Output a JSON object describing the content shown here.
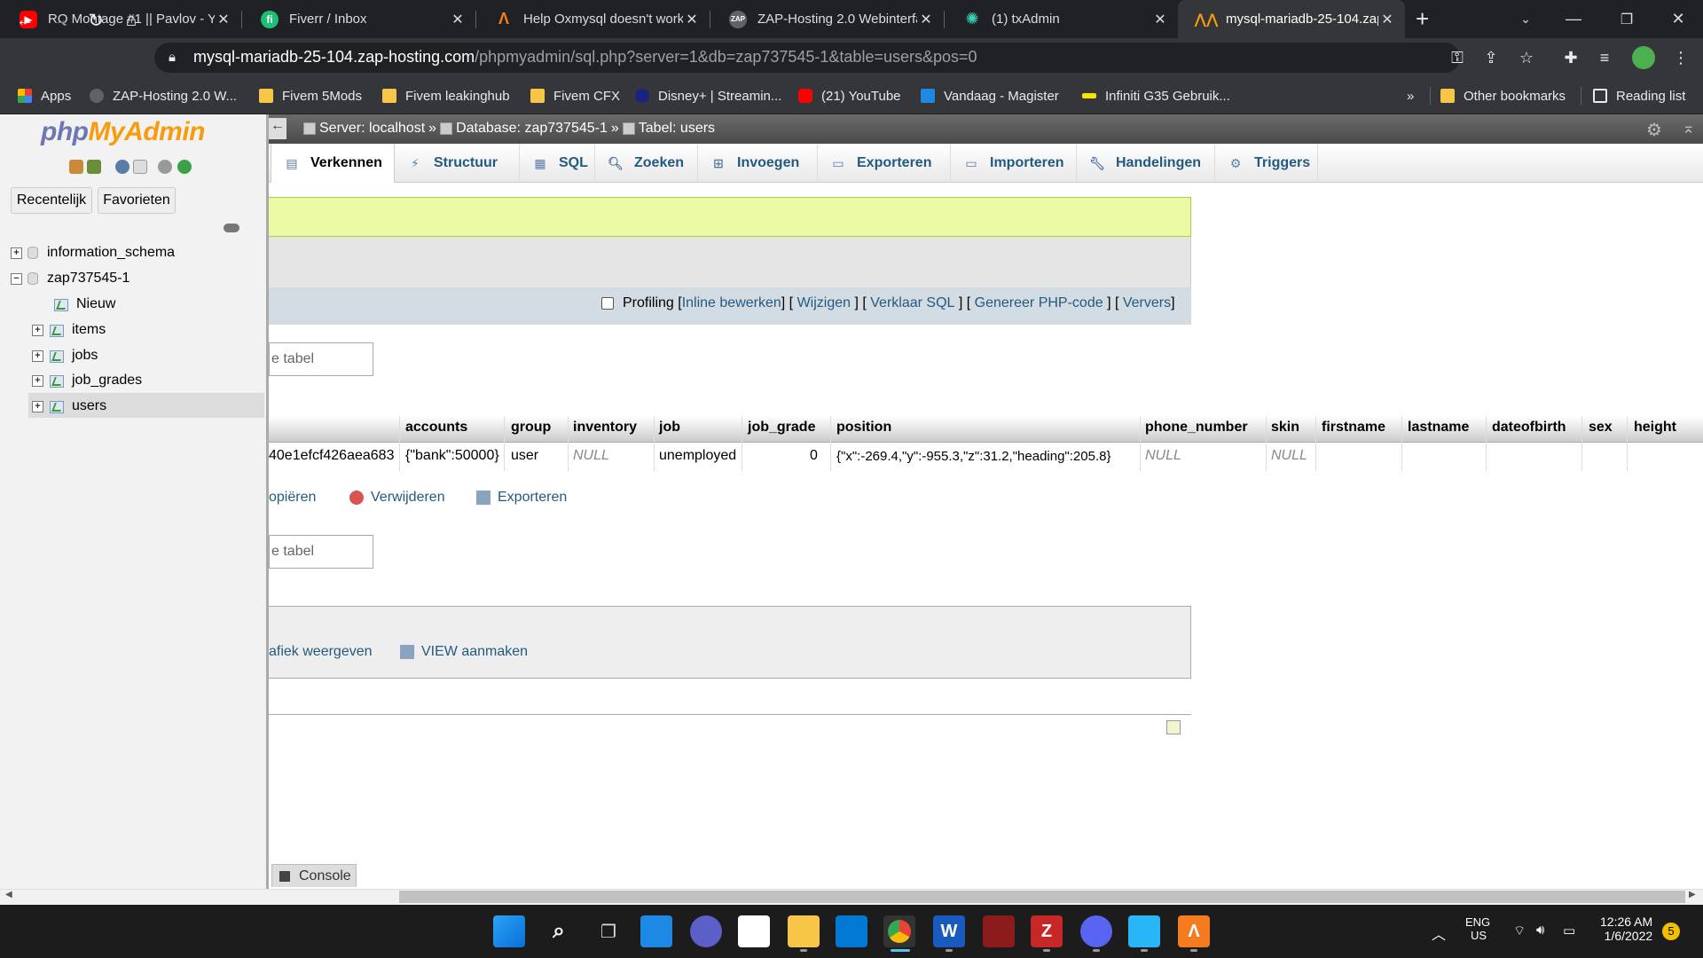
{
  "browser": {
    "tabs": [
      {
        "title": "RQ Montage #1 || Pavlov - Y",
        "icon": "youtube-icon",
        "active": false
      },
      {
        "title": "Fiverr / Inbox",
        "icon": "fiverr-icon",
        "active": false
      },
      {
        "title": "Help Oxmysql doesn't work",
        "icon": "zap-icon",
        "active": false
      },
      {
        "title": "ZAP-Hosting 2.0 Webinterfa",
        "icon": "zap-hosting-icon",
        "active": false
      },
      {
        "title": "(1) txAdmin",
        "icon": "txadmin-icon",
        "active": false
      },
      {
        "title": "mysql-mariadb-25-104.zap",
        "icon": "phpmyadmin-icon",
        "active": true
      }
    ],
    "new_tab": "+",
    "url_host": "mysql-mariadb-25-104.zap-hosting.com",
    "url_path": "/phpmyadmin/sql.php?server=1&db=zap737545-1&table=users&pos=0",
    "bookmarks": [
      {
        "label": "Apps"
      },
      {
        "label": "ZAP-Hosting 2.0 W..."
      },
      {
        "label": "Fivem 5Mods"
      },
      {
        "label": "Fivem leakinghub"
      },
      {
        "label": "Fivem CFX"
      },
      {
        "label": "Disney+ | Streamin..."
      },
      {
        "label": "(21) YouTube"
      },
      {
        "label": "Vandaag - Magister"
      },
      {
        "label": "Infiniti G35 Gebruik..."
      }
    ],
    "bookmarks_more": "»",
    "other_bookmarks": "Other bookmarks",
    "reading_list": "Reading list"
  },
  "pma": {
    "logo_part1": "php",
    "logo_part2": "MyAdmin",
    "recent_label": "Recentelijk",
    "favorites_label": "Favorieten",
    "tree": {
      "db1": "information_schema",
      "db2": "zap737545-1",
      "new": "Nieuw",
      "tables": [
        "items",
        "jobs",
        "job_grades",
        "users"
      ]
    },
    "breadcrumb": {
      "server": "Server: localhost",
      "database": "Database: zap737545-1",
      "table": "Tabel: users",
      "sep": "»"
    },
    "menu": [
      "Verkennen",
      "Structuur",
      "SQL",
      "Zoeken",
      "Invoegen",
      "Exporteren",
      "Importeren",
      "Handelingen",
      "Triggers"
    ],
    "query_links": {
      "profiling": "Profiling",
      "inline": "Inline bewerken",
      "edit": "Wijzigen",
      "explain": "Verklaar SQL",
      "php": "Genereer PHP-code",
      "refresh": "Ververs"
    },
    "filter_placeholder": "e tabel",
    "columns": [
      "accounts",
      "group",
      "inventory",
      "job",
      "job_grade",
      "position",
      "phone_number",
      "skin",
      "firstname",
      "lastname",
      "dateofbirth",
      "sex",
      "height"
    ],
    "row": {
      "identifier_fragment": "40e1efcf426aea683",
      "accounts": "{\"bank\":50000}",
      "group": "user",
      "inventory": "NULL",
      "job": "unemployed",
      "job_grade": "0",
      "position": "{\"x\":-269.4,\"y\":-955.3,\"z\":31.2,\"heading\":205.8}",
      "phone_number": "NULL",
      "skin": "NULL"
    },
    "row_actions": {
      "copy": "opiëren",
      "delete": "Verwijderen",
      "export": "Exporteren"
    },
    "ops": {
      "chart": "afiek weergeven",
      "view": "VIEW aanmaken"
    },
    "console": "Console"
  },
  "taskbar": {
    "lang1": "ENG",
    "lang2": "US",
    "time": "12:26 AM",
    "date": "1/6/2022",
    "notifications": "5"
  },
  "colors": {
    "link": "#235a81",
    "success_bg": "#ebf8a4",
    "chrome_dark": "#202124",
    "chrome_mid": "#35363a"
  }
}
